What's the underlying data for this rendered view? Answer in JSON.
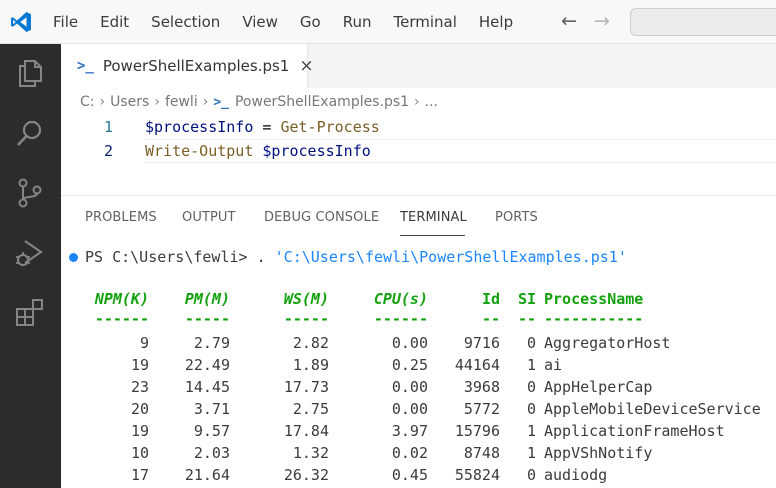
{
  "menu": {
    "items": [
      "File",
      "Edit",
      "Selection",
      "View",
      "Go",
      "Run",
      "Terminal",
      "Help"
    ]
  },
  "nav": {
    "back": "←",
    "forward": "→"
  },
  "icons": {
    "logo": "vscode-logo-icon",
    "activity": [
      "explorer-icon",
      "search-icon",
      "source-control-icon",
      "run-debug-icon",
      "extensions-icon"
    ]
  },
  "colors": {
    "accent": "#1a85ff",
    "terminal_header_green": "#13a10e",
    "activity_bar": "#2c2c2c"
  },
  "tab": {
    "label": "PowerShellExamples.ps1",
    "close": "×",
    "icon": ">_"
  },
  "breadcrumb": {
    "parts": [
      "C:",
      "Users",
      "fewli",
      "PowerShellExamples.ps1",
      "..."
    ]
  },
  "editor": {
    "lines": [
      {
        "num": "1",
        "tokens": [
          "$processInfo",
          " = ",
          "Get-Process"
        ]
      },
      {
        "num": "2",
        "tokens": [
          "Write-Output",
          " ",
          "$processInfo"
        ]
      }
    ]
  },
  "panel": {
    "tabs": [
      "PROBLEMS",
      "OUTPUT",
      "DEBUG CONSOLE",
      "TERMINAL",
      "PORTS"
    ],
    "active_tab": "TERMINAL"
  },
  "terminal": {
    "prompt": "PS C:\\Users\\fewli> ",
    "command_dot": ". ",
    "command_path": "'C:\\Users\\fewli\\PowerShellExamples.ps1'",
    "headers": [
      "NPM(K)",
      "PM(M)",
      "WS(M)",
      "CPU(s)",
      "Id",
      "SI",
      "ProcessName"
    ],
    "underlines": [
      "------",
      "-----",
      "-----",
      "------",
      "--",
      "--",
      "-----------"
    ],
    "rows": [
      [
        "9",
        "2.79",
        "2.82",
        "0.00",
        "9716",
        "0",
        "AggregatorHost"
      ],
      [
        "19",
        "22.49",
        "1.89",
        "0.25",
        "44164",
        "1",
        "ai"
      ],
      [
        "23",
        "14.45",
        "17.73",
        "0.00",
        "3968",
        "0",
        "AppHelperCap"
      ],
      [
        "20",
        "3.71",
        "2.75",
        "0.00",
        "5772",
        "0",
        "AppleMobileDeviceService"
      ],
      [
        "19",
        "9.57",
        "17.84",
        "3.97",
        "15796",
        "1",
        "ApplicationFrameHost"
      ],
      [
        "10",
        "2.03",
        "1.32",
        "0.02",
        "8748",
        "1",
        "AppVShNotify"
      ],
      [
        "17",
        "21.64",
        "26.32",
        "0.45",
        "55824",
        "0",
        "audiodg"
      ]
    ]
  }
}
